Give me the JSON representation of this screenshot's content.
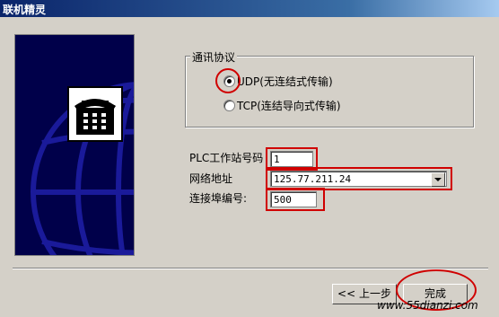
{
  "window": {
    "title": "联机精灵"
  },
  "protocol": {
    "group_title": "通讯协议",
    "options": [
      {
        "label": "UDP(无连结式传输)",
        "selected": true
      },
      {
        "label": "TCP(连结导向式传输)",
        "selected": false
      }
    ]
  },
  "fields": {
    "plc_station": {
      "label": "PLC工作站号码",
      "value": "1"
    },
    "network_address": {
      "label": "网络地址",
      "value": "125.77.211.24"
    },
    "port": {
      "label": "连接埠编号:",
      "value": "500"
    }
  },
  "buttons": {
    "back": "<< 上一步",
    "finish": "完成"
  },
  "watermark": "www.55dianzi.com",
  "colors": {
    "annotation": "#d00000",
    "title_bar": "#0a246a",
    "side_panel": "#00004a"
  }
}
